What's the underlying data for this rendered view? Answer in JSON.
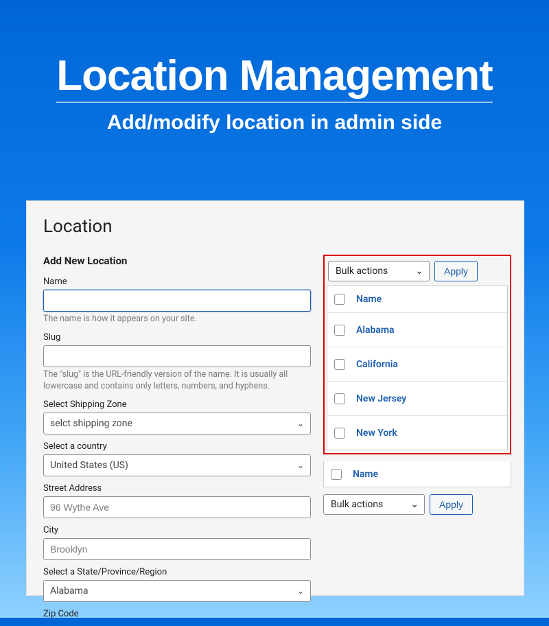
{
  "hero": {
    "title": "Location Management",
    "subtitle": "Add/modify location in admin side"
  },
  "panel": {
    "title": "Location",
    "add_title": "Add New Location",
    "fields": {
      "name": {
        "label": "Name",
        "value": "",
        "hint": "The name is how it appears on your site."
      },
      "slug": {
        "label": "Slug",
        "value": "",
        "hint": "The \"slug\" is the URL-friendly version of the name. It is usually all lowercase and contains only letters, numbers, and hyphens."
      },
      "shipping_zone": {
        "label": "Select Shipping Zone",
        "value": "selct shipping zone"
      },
      "country": {
        "label": "Select a country",
        "value": "United States (US)"
      },
      "street": {
        "label": "Street Address",
        "value": "",
        "placeholder": "96 Wythe Ave"
      },
      "city": {
        "label": "City",
        "value": "",
        "placeholder": "Brooklyn"
      },
      "state": {
        "label": "Select a State/Province/Region",
        "value": "Alabama"
      },
      "zip": {
        "label": "Zip Code"
      }
    }
  },
  "table": {
    "bulk_label": "Bulk actions",
    "apply_label": "Apply",
    "header": "Name",
    "rows": [
      "Alabama",
      "California",
      "New Jersey",
      "New York"
    ]
  }
}
